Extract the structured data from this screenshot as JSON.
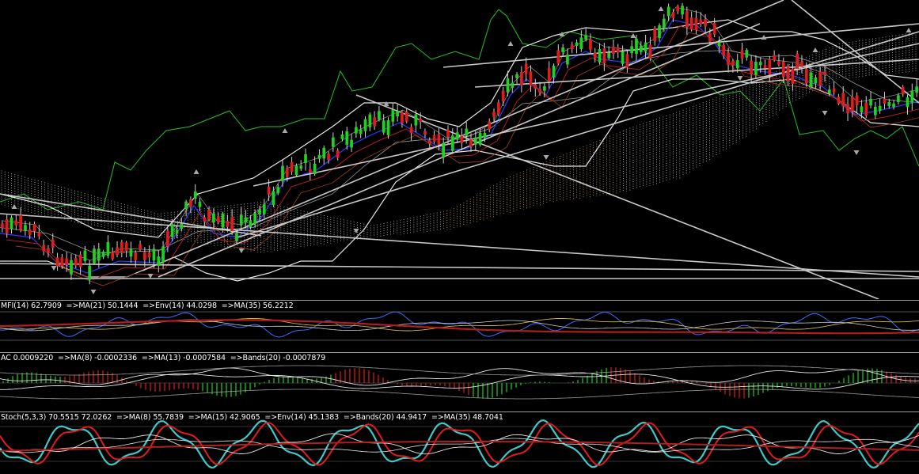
{
  "chart_data": [
    {
      "type": "candlestick",
      "panel": "price",
      "overlays": [
        "Ichimoku cloud",
        "Bollinger Bands",
        "Moving averages",
        "Envelopes",
        "Trend lines",
        "Fractal arrows"
      ],
      "candles": {
        "count": 200,
        "trend": "down-range then strong rally then pullback"
      },
      "colors": {
        "bull": "#1fd21f",
        "bear": "#e01c1c",
        "chikou": "#22c322",
        "cloud": "#cfcfcf",
        "bands": "#e6e6e6",
        "ma_blue": "#2b3cff",
        "ma_red": "#b01e1e",
        "trendline": "#c8c8c8"
      }
    },
    {
      "type": "line",
      "panel": "mfi",
      "label": "MFI(14) 62.7909  =>MA(21) 50.1444  =>Env(14) 44.0298  =>MA(35) 56.2212",
      "colors": {
        "mfi": "#3d6cff",
        "ma": "#c0392b",
        "env": "#d4b43a",
        "ma35": "#b01e1e"
      }
    },
    {
      "type": "bar",
      "panel": "ac",
      "label": "AC 0.0009220  =>MA(8) -0.0002336  =>MA(13) -0.0007584  =>Bands(20) -0.0007879",
      "colors": {
        "up": "#1fd21f",
        "down": "#e01c1c",
        "lines": "#e6e6e6"
      }
    },
    {
      "type": "line",
      "panel": "stoch",
      "label": "Stoch(5,3,3) 70.5515 72.0262  =>MA(8) 55.7839  =>MA(15) 42.9065  =>Env(14) 45.1383  =>Bands(20) 44.9417  =>MA(35) 48.7041",
      "colors": {
        "main": "#3ec8c8",
        "signal": "#e01c1c",
        "lines": "#e6e6e6",
        "ma35": "#b01e1e"
      }
    }
  ],
  "panels": {
    "mfi_label": "MFI(14) 62.7909  =>MA(21) 50.1444  =>Env(14) 44.0298  =>MA(35) 56.2212",
    "ac_label": "AC 0.0009220  =>MA(8) -0.0002336  =>MA(13) -0.0007584  =>Bands(20) -0.0007879",
    "stoch_label": "Stoch(5,3,3) 70.5515 72.0262  =>MA(8) 55.7839  =>MA(15) 42.9065  =>Env(14) 45.1383  =>Bands(20) 44.9417  =>MA(35) 48.7041"
  }
}
